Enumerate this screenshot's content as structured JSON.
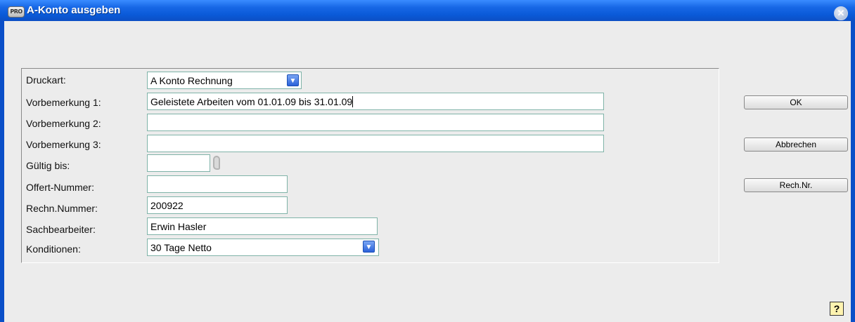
{
  "window": {
    "title": "A-Konto ausgeben",
    "app_icon": "PRO",
    "close_icon": "close-icon"
  },
  "form": {
    "druckart": {
      "label": "Druckart:",
      "value": "A Konto Rechnung"
    },
    "vorbemerkung1": {
      "label": "Vorbemerkung 1:",
      "value": "Geleistete Arbeiten vom 01.01.09 bis 31.01.09"
    },
    "vorbemerkung2": {
      "label": "Vorbemerkung 2:",
      "value": ""
    },
    "vorbemerkung3": {
      "label": "Vorbemerkung 3:",
      "value": ""
    },
    "gueltig_bis": {
      "label": "Gültig bis:",
      "value": ""
    },
    "offert_nummer": {
      "label": "Offert-Nummer:",
      "value": ""
    },
    "rechn_nummer": {
      "label": "Rechn.Nummer:",
      "value": "200922"
    },
    "sachbearbeiter": {
      "label": "Sachbearbeiter:",
      "value": "Erwin Hasler"
    },
    "konditionen": {
      "label": "Konditionen:",
      "value": "30 Tage Netto"
    }
  },
  "buttons": {
    "ok": "OK",
    "abbrechen": "Abbrechen",
    "rech_nr": "Rech.Nr."
  },
  "help": {
    "label": "?"
  },
  "colors": {
    "title_bar": "#0a5ad8",
    "field_border": "#7fb3a8",
    "window_bg": "#ececec"
  }
}
